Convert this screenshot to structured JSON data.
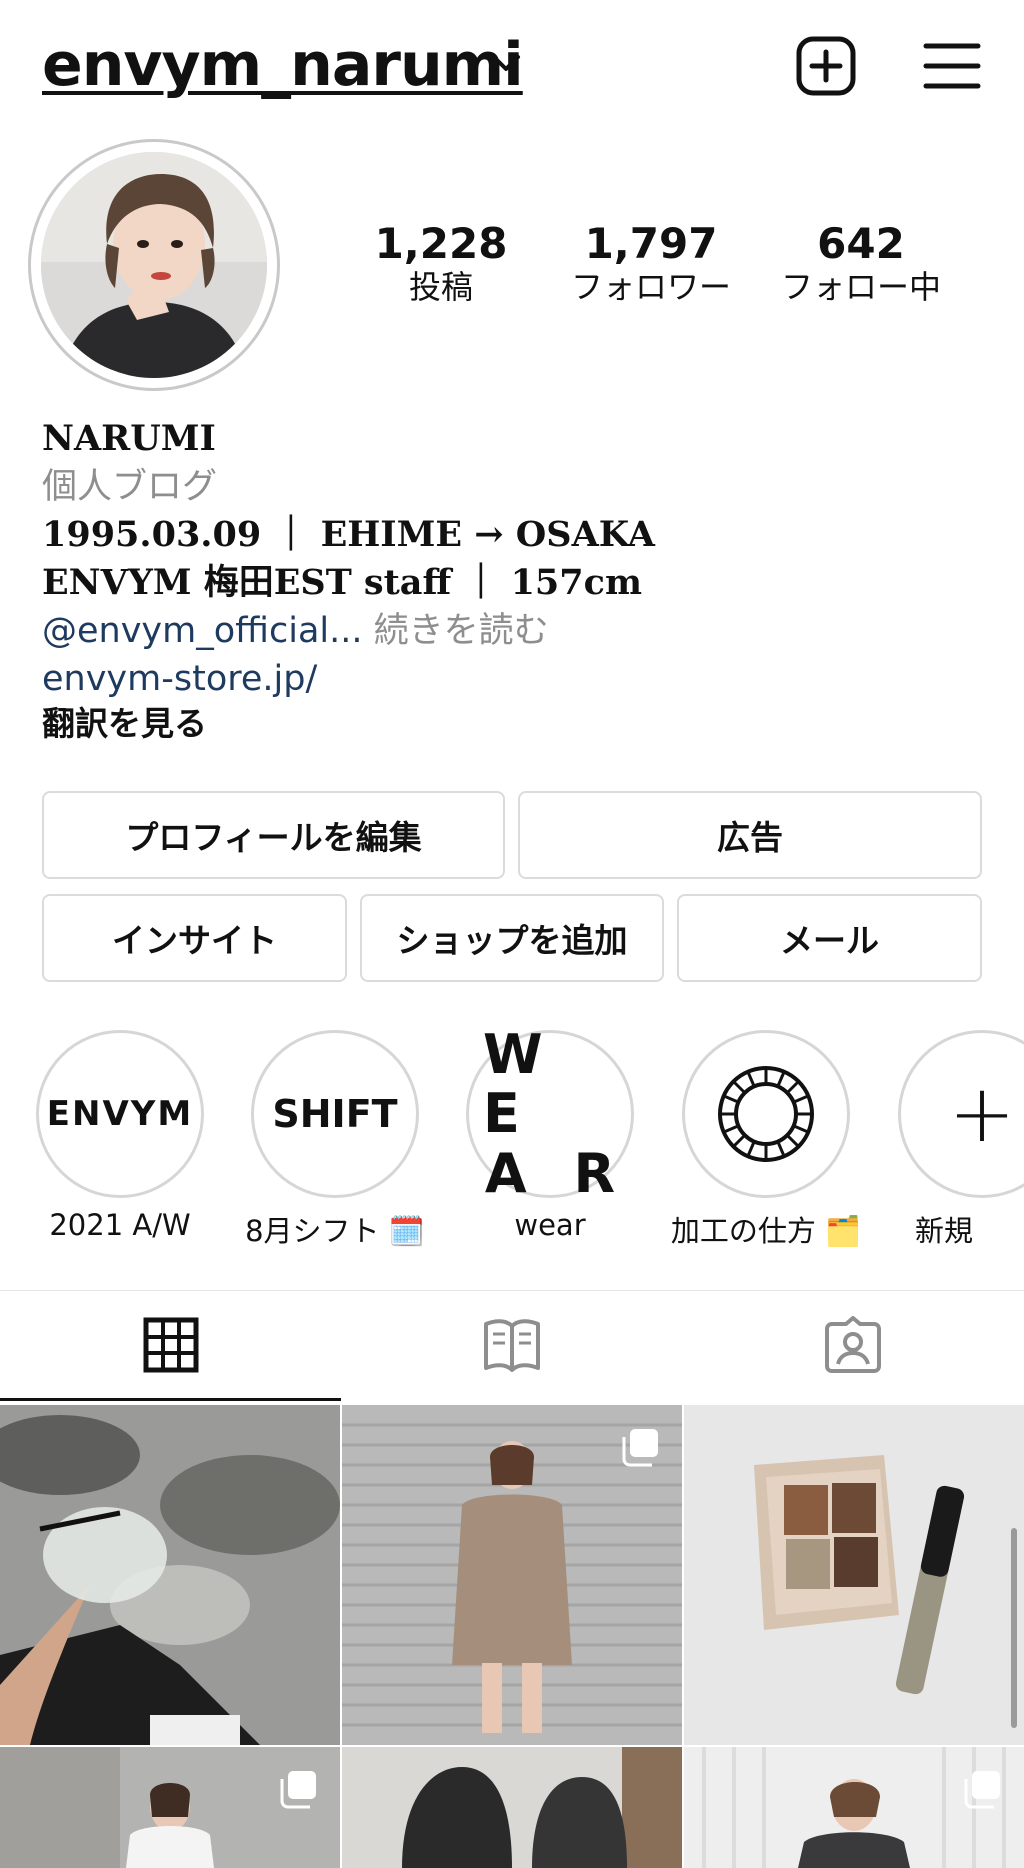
{
  "header": {
    "username": "envym_narumi",
    "icons": [
      "chevron-down-icon",
      "new-post-icon",
      "menu-icon"
    ]
  },
  "profile": {
    "posts_count": "1,228",
    "posts_label": "投稿",
    "followers_count": "1,797",
    "followers_label": "フォロワー",
    "following_count": "642",
    "following_label": "フォロー中"
  },
  "bio": {
    "name": "NARUMI",
    "category": "個人ブログ",
    "line1": "1995.03.09 ｜ EHIME → OSAKA",
    "line2": "ENVYM 梅田EST staff ｜ 157cm",
    "mention": "@envym_official...",
    "more": " 続きを読む",
    "website": "envym-store.jp/",
    "translate": "翻訳を見る"
  },
  "buttons": {
    "edit_profile": "プロフィールを編集",
    "ads": "広告",
    "insights": "インサイト",
    "add_shop": "ショップを追加",
    "email": "メール"
  },
  "highlights": [
    {
      "cover_text": "ENVYM",
      "label": "2021 A/W"
    },
    {
      "cover_text": "SHIFT",
      "label": "8月シフト 🗓️"
    },
    {
      "cover_text": "W E\nA R",
      "cover_top": "W E",
      "cover_bottom": "A R",
      "label": "wear"
    },
    {
      "cover_text": "",
      "label": "加工の仕方 🗂️"
    },
    {
      "cover_text": "+",
      "label": "新規"
    }
  ],
  "tabs": [
    "grid-icon",
    "guide-icon",
    "tagged-icon"
  ],
  "colors": {
    "link": "#1e3a5f",
    "secondary_text": "#8e8e8e",
    "border": "#dbdbdb"
  }
}
